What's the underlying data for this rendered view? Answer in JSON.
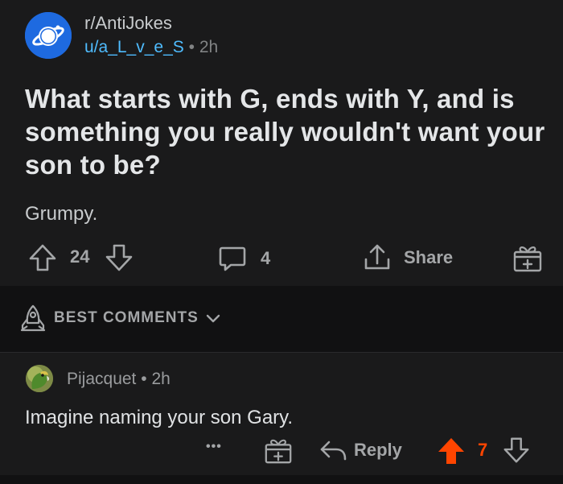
{
  "post": {
    "subreddit": "r/AntiJokes",
    "author": "u/a_L_v_e_S",
    "separator": "•",
    "age": "2h",
    "title": "What starts with G, ends with Y, and is something you really wouldn't want your son to be?",
    "body": "Grumpy.",
    "score": "24",
    "comment_count": "4",
    "share_label": "Share"
  },
  "comments_header": {
    "label": "BEST COMMENTS"
  },
  "comment": {
    "author": "Pijacquet",
    "separator": "•",
    "age": "2h",
    "body": "Imagine naming your son Gary.",
    "more_label": "•••",
    "reply_label": "Reply",
    "score": "7"
  },
  "colors": {
    "background": "#1a1a1b",
    "user_link": "#4fbcff",
    "upvoted": "#ff4500",
    "text": "#d7dadc"
  },
  "icons": [
    "planet-icon",
    "upvote-icon",
    "downvote-icon",
    "comment-icon",
    "share-icon",
    "gift-icon",
    "rocket-icon",
    "chevron-down-icon",
    "reply-icon"
  ]
}
